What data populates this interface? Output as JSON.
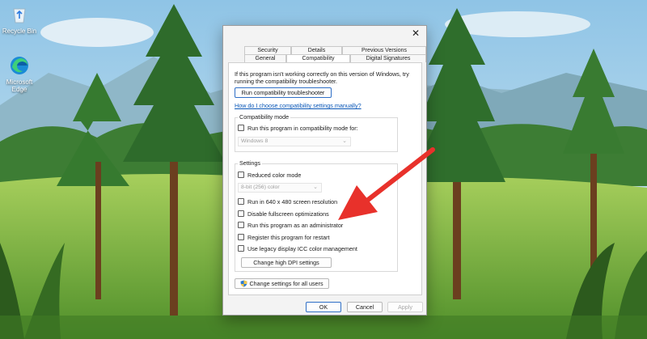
{
  "desktop": {
    "icons": [
      {
        "label": "Recycle Bin",
        "icon": "recycle-bin-icon"
      },
      {
        "label": "Microsoft Edge",
        "icon": "edge-browser-icon"
      }
    ]
  },
  "dialog": {
    "close_glyph": "✕",
    "tabs_row1": [
      "Security",
      "Details",
      "Previous Versions"
    ],
    "tabs_row2": [
      "General",
      "Compatibility",
      "Digital Signatures"
    ],
    "active_tab": "Compatibility",
    "intro_text": "If this program isn't working correctly on this version of Windows, try running the compatibility troubleshooter.",
    "troubleshoot_button": "Run compatibility troubleshooter",
    "help_link": "How do I choose compatibility settings manually?",
    "compat_group": {
      "title": "Compatibility mode",
      "checkbox_label": "Run this program in compatibility mode for:",
      "checked": false,
      "os_select": "Windows 8"
    },
    "settings_group": {
      "title": "Settings",
      "reduced_color": {
        "label": "Reduced color mode",
        "checked": false
      },
      "color_select": "8-bit (256) color",
      "options": [
        {
          "label": "Run in 640 x 480 screen resolution",
          "checked": false
        },
        {
          "label": "Disable fullscreen optimizations",
          "checked": false
        },
        {
          "label": "Run this program as an administrator",
          "checked": false
        },
        {
          "label": "Register this program for restart",
          "checked": false
        },
        {
          "label": "Use legacy display ICC color management",
          "checked": false
        }
      ],
      "dpi_button": "Change high DPI settings"
    },
    "all_users_button": "Change settings for all users",
    "footer": {
      "ok": "OK",
      "cancel": "Cancel",
      "apply": "Apply"
    }
  },
  "annotation": {
    "arrow_color": "#e8312b"
  },
  "colors": {
    "accent": "#2f6fc6",
    "link": "#0a57b7"
  }
}
